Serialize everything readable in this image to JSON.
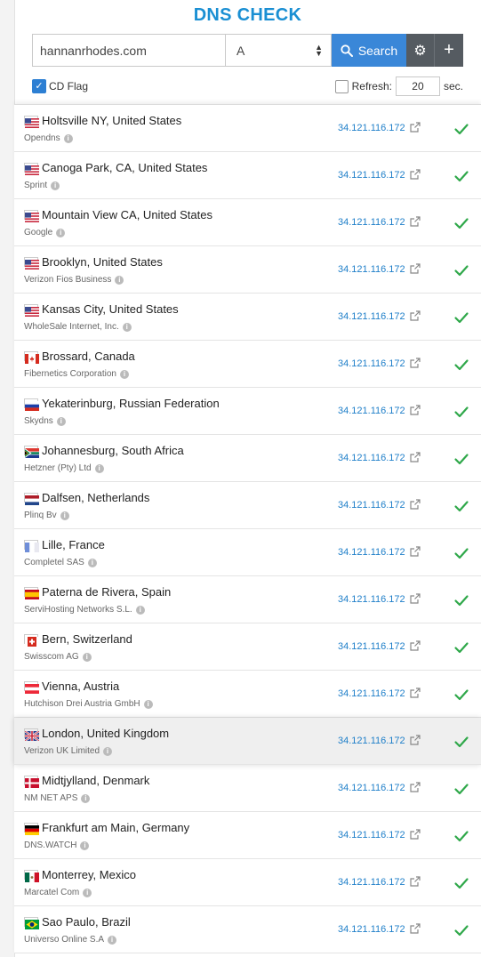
{
  "app": {
    "title": "DNS CHECK"
  },
  "search": {
    "domain": "hannanrhodes.com",
    "record_type": "A",
    "search_label": "Search",
    "settings_icon": "gear-icon",
    "add_icon": "plus-icon"
  },
  "options": {
    "cd_flag_label": "CD Flag",
    "cd_flag_checked": true,
    "refresh_label": "Refresh:",
    "refresh_checked": false,
    "refresh_value": "20",
    "refresh_unit": "sec."
  },
  "colors": {
    "accent": "#1a8fd3",
    "button": "#3a87d8",
    "dark_button": "#555b61",
    "success": "#2fa84a",
    "ip_link": "#1f7fc9"
  },
  "results": [
    {
      "country": "us",
      "location": "Holtsville NY, United States",
      "provider": "Opendns",
      "ip": "34.121.116.172",
      "status": "ok"
    },
    {
      "country": "us",
      "location": "Canoga Park, CA, United States",
      "provider": "Sprint",
      "ip": "34.121.116.172",
      "status": "ok"
    },
    {
      "country": "us",
      "location": "Mountain View CA, United States",
      "provider": "Google",
      "ip": "34.121.116.172",
      "status": "ok"
    },
    {
      "country": "us",
      "location": "Brooklyn, United States",
      "provider": "Verizon Fios Business",
      "ip": "34.121.116.172",
      "status": "ok"
    },
    {
      "country": "us",
      "location": "Kansas City, United States",
      "provider": "WholeSale Internet, Inc.",
      "ip": "34.121.116.172",
      "status": "ok"
    },
    {
      "country": "ca",
      "location": "Brossard, Canada",
      "provider": "Fibernetics Corporation",
      "ip": "34.121.116.172",
      "status": "ok"
    },
    {
      "country": "ru",
      "location": "Yekaterinburg, Russian Federation",
      "provider": "Skydns",
      "ip": "34.121.116.172",
      "status": "ok"
    },
    {
      "country": "za",
      "location": "Johannesburg, South Africa",
      "provider": "Hetzner (Pty) Ltd",
      "ip": "34.121.116.172",
      "status": "ok"
    },
    {
      "country": "nl",
      "location": "Dalfsen, Netherlands",
      "provider": "Plinq Bv",
      "ip": "34.121.116.172",
      "status": "ok"
    },
    {
      "country": "fr",
      "location": "Lille, France",
      "provider": "Completel SAS",
      "ip": "34.121.116.172",
      "status": "ok"
    },
    {
      "country": "es",
      "location": "Paterna de Rivera, Spain",
      "provider": "ServiHosting Networks S.L.",
      "ip": "34.121.116.172",
      "status": "ok"
    },
    {
      "country": "ch",
      "location": "Bern, Switzerland",
      "provider": "Swisscom AG",
      "ip": "34.121.116.172",
      "status": "ok"
    },
    {
      "country": "at",
      "location": "Vienna, Austria",
      "provider": "Hutchison Drei Austria GmbH",
      "ip": "34.121.116.172",
      "status": "ok"
    },
    {
      "country": "gb",
      "location": "London, United Kingdom",
      "provider": "Verizon UK Limited",
      "ip": "34.121.116.172",
      "status": "ok",
      "highlighted": true
    },
    {
      "country": "dk",
      "location": "Midtjylland, Denmark",
      "provider": "NM NET APS",
      "ip": "34.121.116.172",
      "status": "ok"
    },
    {
      "country": "de",
      "location": "Frankfurt am Main, Germany",
      "provider": "DNS.WATCH",
      "ip": "34.121.116.172",
      "status": "ok"
    },
    {
      "country": "mx",
      "location": "Monterrey, Mexico",
      "provider": "Marcatel Com",
      "ip": "34.121.116.172",
      "status": "ok"
    },
    {
      "country": "br",
      "location": "Sao Paulo, Brazil",
      "provider": "Universo Online S.A",
      "ip": "34.121.116.172",
      "status": "ok"
    }
  ]
}
